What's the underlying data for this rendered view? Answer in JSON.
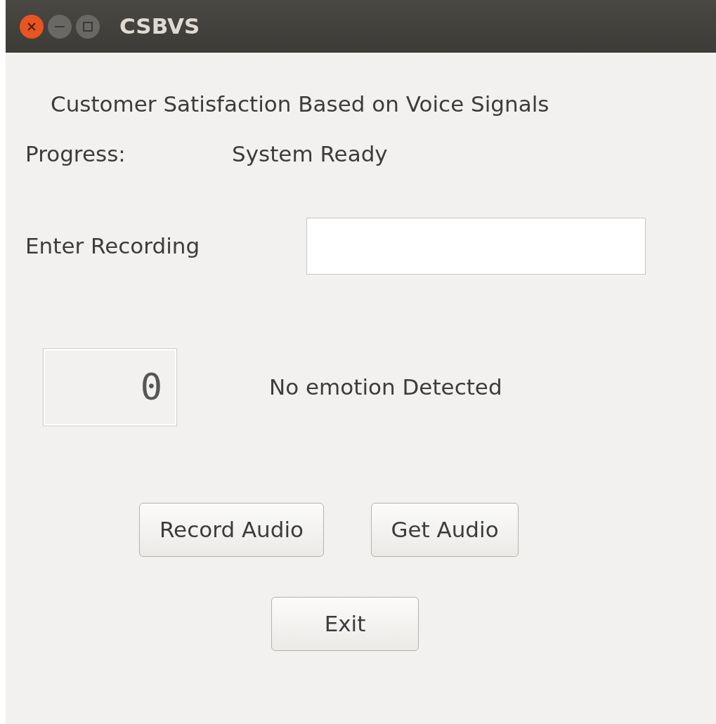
{
  "window": {
    "title": "CSBVS"
  },
  "heading": "Customer Satisfaction Based on Voice Signals",
  "progress": {
    "label": "Progress:",
    "value": "System Ready"
  },
  "recording": {
    "label": "Enter Recording"
  },
  "lcd": {
    "reading": "0"
  },
  "emotion": "No emotion Detected",
  "buttons": [
    "Record Audio",
    "Get Audio"
  ],
  "exit": "Exit"
}
